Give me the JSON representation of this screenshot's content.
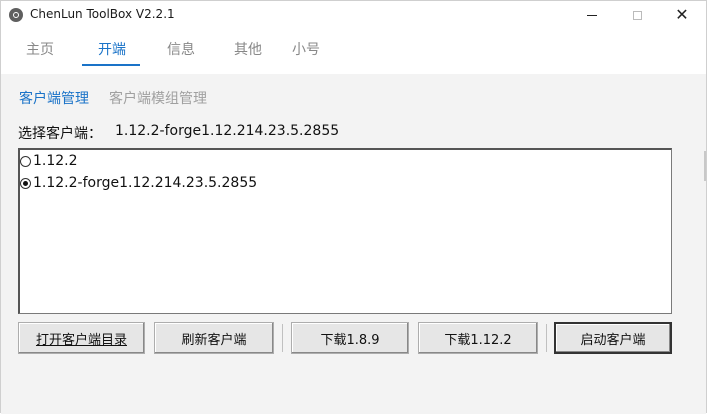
{
  "window": {
    "title": "ChenLun ToolBox V2.2.1",
    "close_glyph": "✕"
  },
  "tabs": [
    {
      "label": "主页",
      "active": false
    },
    {
      "label": "开端",
      "active": true
    },
    {
      "label": "信息",
      "active": false
    },
    {
      "label": "其他",
      "active": false
    },
    {
      "label": "小号",
      "active": false
    }
  ],
  "subtabs": [
    {
      "label": "客户端管理",
      "active": true
    },
    {
      "label": "客户端模组管理",
      "active": false
    }
  ],
  "client_select": {
    "label": "选择客户端：",
    "value": "1.12.2-forge1.12.214.23.5.2855"
  },
  "clients": [
    {
      "label": "1.12.2",
      "checked": false
    },
    {
      "label": "1.12.2-forge1.12.214.23.5.2855",
      "checked": true
    }
  ],
  "buttons": {
    "open_dir": "打开客户端目录",
    "refresh": "刷新客户端",
    "download_189": "下载1.8.9",
    "download_1122": "下载1.12.2",
    "launch": "启动客户端"
  },
  "colors": {
    "accent": "#1a73c8",
    "content_bg": "#f3f3f3"
  }
}
